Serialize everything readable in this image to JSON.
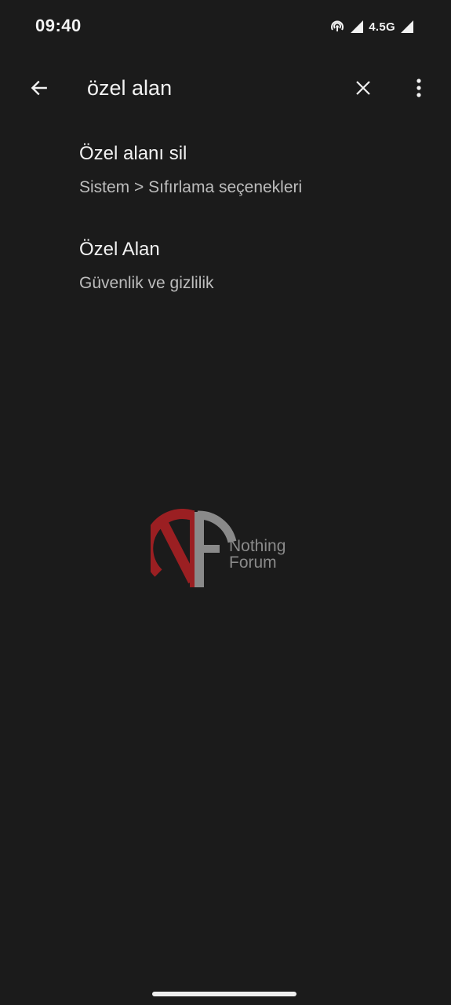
{
  "status_bar": {
    "time": "09:40",
    "network": "4.5G",
    "icons": [
      "hotspot-icon",
      "signal-icon",
      "signal-icon"
    ]
  },
  "search": {
    "query": "özel alan",
    "back_icon": "arrow-left-icon",
    "clear_icon": "close-icon",
    "more_icon": "more-vertical-icon"
  },
  "results": [
    {
      "title": "Özel alanı sil",
      "subtitle": "Sistem > Sıfırlama seçenekleri"
    },
    {
      "title": "Özel Alan",
      "subtitle": "Güvenlik ve gizlilik"
    }
  ],
  "watermark": {
    "line1": "Nothing",
    "line2": "Forum",
    "colors": {
      "red": "#9b1f22",
      "gray": "#8a8a8a"
    }
  },
  "colors": {
    "background": "#1b1b1b",
    "text_primary": "#f2f2f2",
    "text_secondary": "#bdbdbd"
  }
}
